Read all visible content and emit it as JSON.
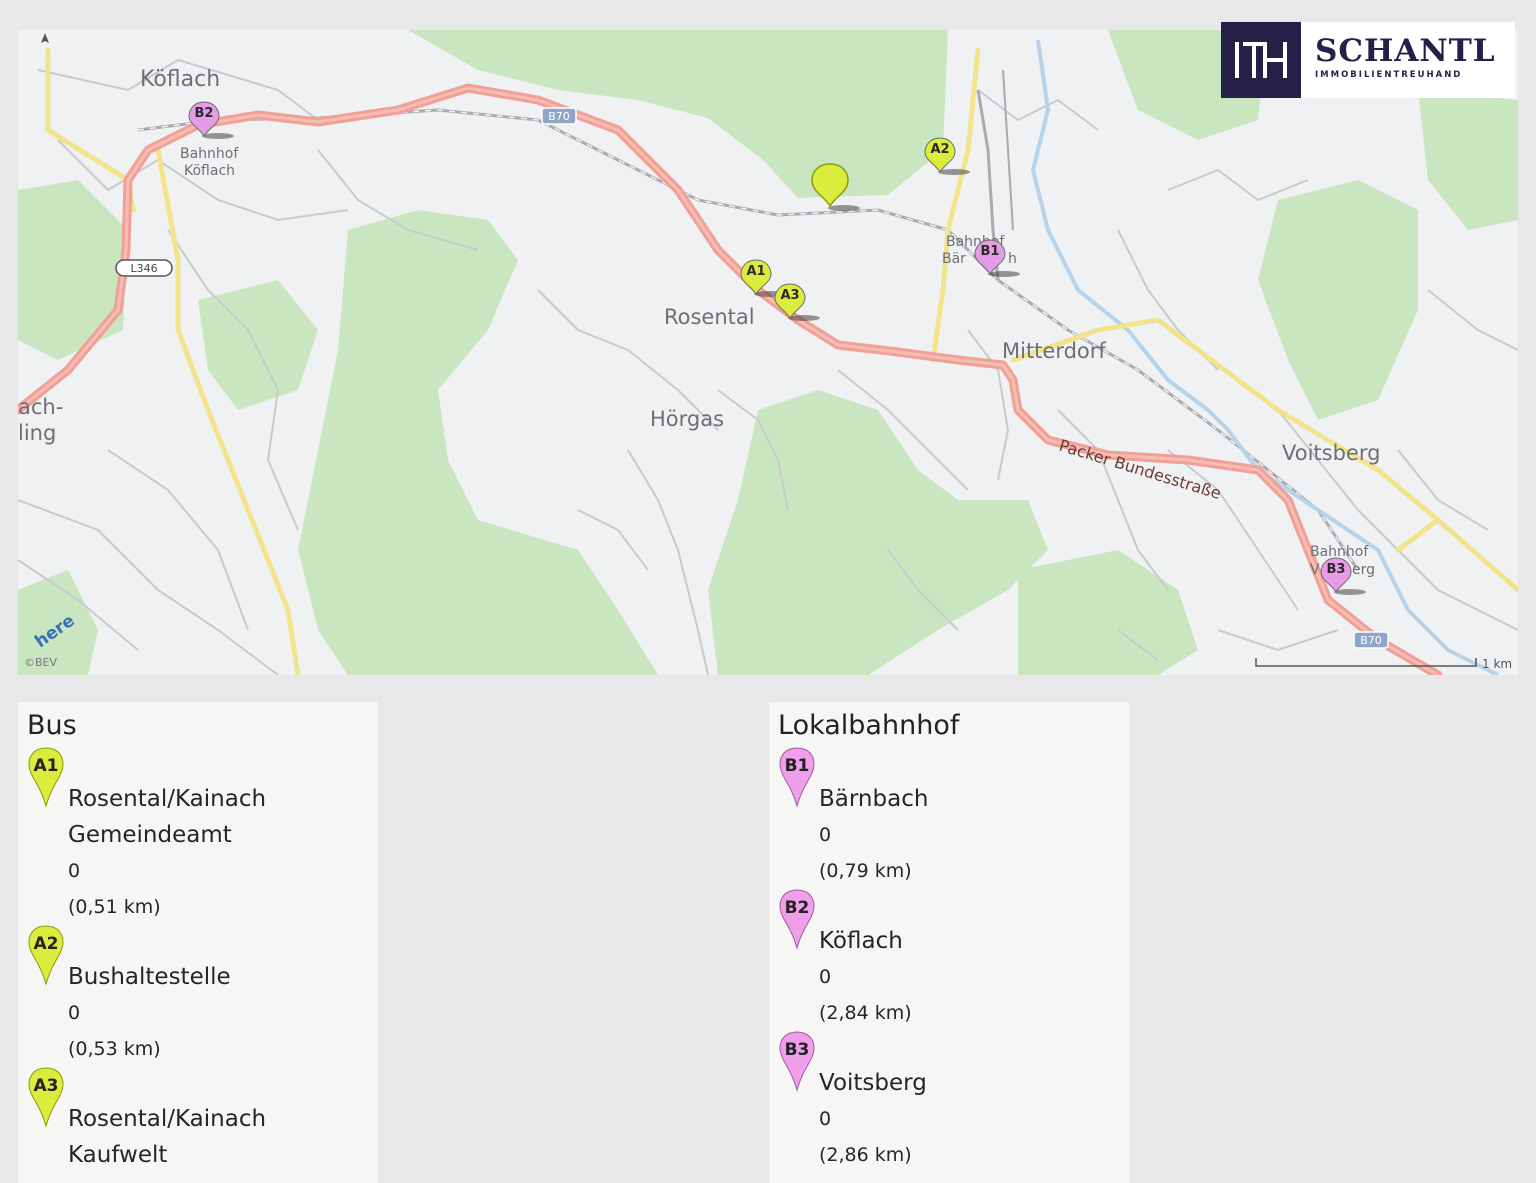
{
  "logo": {
    "brand": "SCHANTL",
    "tagline": "IMMOBILIENTREUHAND",
    "mark": "ITH"
  },
  "map": {
    "places": {
      "koeflach": "Köflach",
      "rosental": "Rosental",
      "hoergas": "Hörgas",
      "mitterdorf": "Mitterdorf",
      "voitsberg": "Voitsberg",
      "bach_line1": "ach-",
      "bach_line2": "ling",
      "bhf_koeflach_1": "Bahnhof",
      "bhf_koeflach_2": "Köflach",
      "bhf_baernbach_1": "Bahnhof",
      "bhf_baernbach_2": "Bär",
      "bhf_baernbach_3": "h",
      "bhf_voitsberg_1": "Bahnhof",
      "bhf_voitsberg_2": "V",
      "bhf_voitsberg_3": "erg"
    },
    "road_label": "Packer Bundesstraße",
    "road_shields": {
      "b70_a": "B70",
      "b70_b": "B70",
      "l346": "L346"
    },
    "markers": [
      {
        "id": "B2",
        "color": "#e79ae6"
      },
      {
        "id": "B1",
        "color": "#e79ae6"
      },
      {
        "id": "B3",
        "color": "#e79ae6"
      },
      {
        "id": "A1",
        "color": "#dcec3c"
      },
      {
        "id": "A2",
        "color": "#dcec3c"
      },
      {
        "id": "A3",
        "color": "#dcec3c"
      }
    ],
    "property_marker_color": "#dcec3c",
    "here_logo": "here",
    "copyright": "©BEV",
    "scale_label": "1 km",
    "colors": {
      "road_main": "#f2a197",
      "road_yellow": "#f3e58c",
      "forest": "#c6e4bd",
      "water": "#b7d3ea"
    }
  },
  "bus_panel": {
    "title": "Bus",
    "stops": [
      {
        "id": "A1",
        "name_line1": "Rosental/Kainach",
        "name_line2": "Gemeindeamt",
        "count": "0",
        "distance": "(0,51 km)"
      },
      {
        "id": "A2",
        "name_line1": "Bushaltestelle",
        "count": "0",
        "distance": "(0,53 km)"
      },
      {
        "id": "A3",
        "name_line1": "Rosental/Kainach",
        "name_line2": "Kaufwelt"
      }
    ]
  },
  "rail_panel": {
    "title": "Lokalbahnhof",
    "stops": [
      {
        "id": "B1",
        "name_line1": "Bärnbach",
        "count": "0",
        "distance": "(0,79 km)"
      },
      {
        "id": "B2",
        "name_line1": "Köflach",
        "count": "0",
        "distance": "(2,84 km)"
      },
      {
        "id": "B3",
        "name_line1": "Voitsberg",
        "count": "0",
        "distance": "(2,86 km)"
      }
    ]
  }
}
